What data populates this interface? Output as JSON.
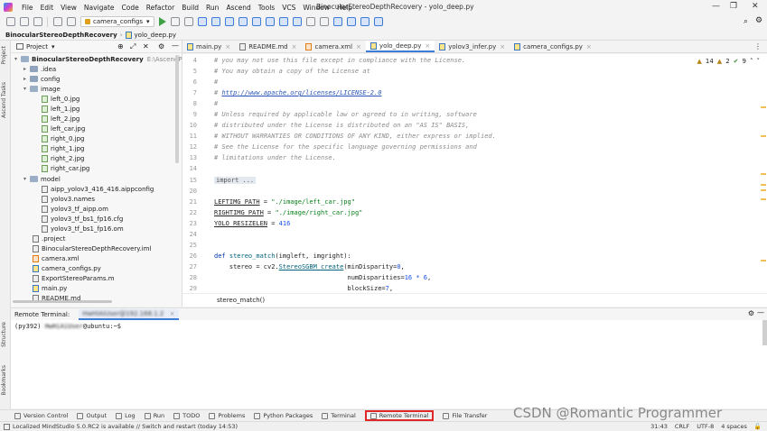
{
  "menubar": {
    "items": [
      "File",
      "Edit",
      "View",
      "Navigate",
      "Code",
      "Refactor",
      "Build",
      "Run",
      "Ascend",
      "Tools",
      "VCS",
      "Window",
      "Help"
    ],
    "title": "BinocularStereoDepthRecovery - yolo_deep.py"
  },
  "toolbar": {
    "run_config": "camera_configs"
  },
  "breadcrumb": {
    "project": "BinocularStereoDepthRecovery",
    "file": "yolo_deep.py"
  },
  "left_strip": {
    "project": "Project",
    "autotasks": "Ascend Tasks",
    "structure": "Structure",
    "bookmarks": "Bookmarks"
  },
  "project_panel": {
    "title": "Project",
    "root": "BinocularStereoDepthRecovery",
    "root_path": "E:\\AscendProjects",
    "items": [
      {
        "label": ".idea"
      },
      {
        "label": "config"
      },
      {
        "label": "image"
      },
      {
        "label": "left_0.jpg"
      },
      {
        "label": "left_1.jpg"
      },
      {
        "label": "left_2.jpg"
      },
      {
        "label": "left_car.jpg"
      },
      {
        "label": "right_0.jpg"
      },
      {
        "label": "right_1.jpg"
      },
      {
        "label": "right_2.jpg"
      },
      {
        "label": "right_car.jpg"
      },
      {
        "label": "model"
      },
      {
        "label": "aipp_yolov3_416_416.aippconfig"
      },
      {
        "label": "yolov3.names"
      },
      {
        "label": "yolov3_tf_aipp.om"
      },
      {
        "label": "yolov3_tf_bs1_fp16.cfg"
      },
      {
        "label": "yolov3_tf_bs1_fp16.om"
      },
      {
        "label": ".project"
      },
      {
        "label": "BinocularStereoDepthRecovery.iml"
      },
      {
        "label": "camera.xml"
      },
      {
        "label": "camera_configs.py"
      },
      {
        "label": "ExportStereoParams.m"
      },
      {
        "label": "main.py"
      },
      {
        "label": "README.md"
      }
    ]
  },
  "tabs": [
    {
      "label": "main.py"
    },
    {
      "label": "README.md"
    },
    {
      "label": "camera.xml"
    },
    {
      "label": "yolo_deep.py"
    },
    {
      "label": "yolov3_infer.py"
    },
    {
      "label": "camera_configs.py"
    }
  ],
  "inspections": {
    "warnings": "14",
    "weak": "2",
    "ok": "9"
  },
  "editor": {
    "line_numbers": [
      "4",
      "5",
      "6",
      "7",
      "8",
      "9",
      "10",
      "11",
      "12",
      "13",
      "14",
      "15",
      "20",
      "21",
      "22",
      "23",
      "24",
      "25",
      "26",
      "27",
      "28",
      "29"
    ],
    "lines": {
      "l4": "# you may not use this file except in compliance with the License.",
      "l5": "# You may obtain a copy of the License at",
      "l6": "#",
      "l7a": "# ",
      "l7b": "http://www.apache.org/licenses/LICENSE-2.0",
      "l8": "#",
      "l9": "# Unless required by applicable law or agreed to in writing, software",
      "l10": "# distributed under the License is distributed on an \"AS IS\" BASIS,",
      "l11": "# WITHOUT WARRANTIES OR CONDITIONS OF ANY KIND, either express or implied.",
      "l12": "# See the License for the specific language governing permissions and",
      "l13": "# limitations under the License.",
      "l15": "import ...",
      "l21a": "LEFTIMG_PATH",
      "l21b": " = ",
      "l21c": "\"./image/left_car.jpg\"",
      "l22a": "RIGHTIMG_PATH",
      "l22b": " = ",
      "l22c": "\"./image/right_car.jpg\"",
      "l23a": "YOLO_RESIZELEN",
      "l23b": " = ",
      "l23c": "416",
      "l26a": "def ",
      "l26b": "stereo_match",
      "l26c": "(imgleft, imgright):",
      "l27a": "    stereo = cv2.",
      "l27b": "StereoSGBM_create",
      "l27c": "(minDisparity=",
      "l27d": "0",
      "l27e": ",",
      "l28a": "                                   numDisparities=",
      "l28b": "16 * 6",
      "l28c": ",",
      "l29a": "                                   blockSize=",
      "l29b": "7",
      "l29c": ","
    }
  },
  "editor_crumb": "stereo_match()",
  "terminal": {
    "header": "Remote Terminal:",
    "tab": "HwHiAiUser@192.168.1.2",
    "prompt_env": "(py392) ",
    "prompt_user": "HwHiAiUser",
    "prompt_host": "@ubuntu:~$"
  },
  "bottombar": [
    "Version Control",
    "Output",
    "Log",
    "Run",
    "TODO",
    "Problems",
    "Python Packages",
    "Terminal",
    "Remote Terminal",
    "File Transfer"
  ],
  "statusbar": {
    "message": "Localized MindStudio 5.0.RC2 is available // Switch and restart (today 14:53)",
    "pos": "31:43",
    "eol": "CRLF",
    "enc": "UTF-8",
    "indent": "4 spaces"
  },
  "watermark": "CSDN @Romantic Programmer"
}
